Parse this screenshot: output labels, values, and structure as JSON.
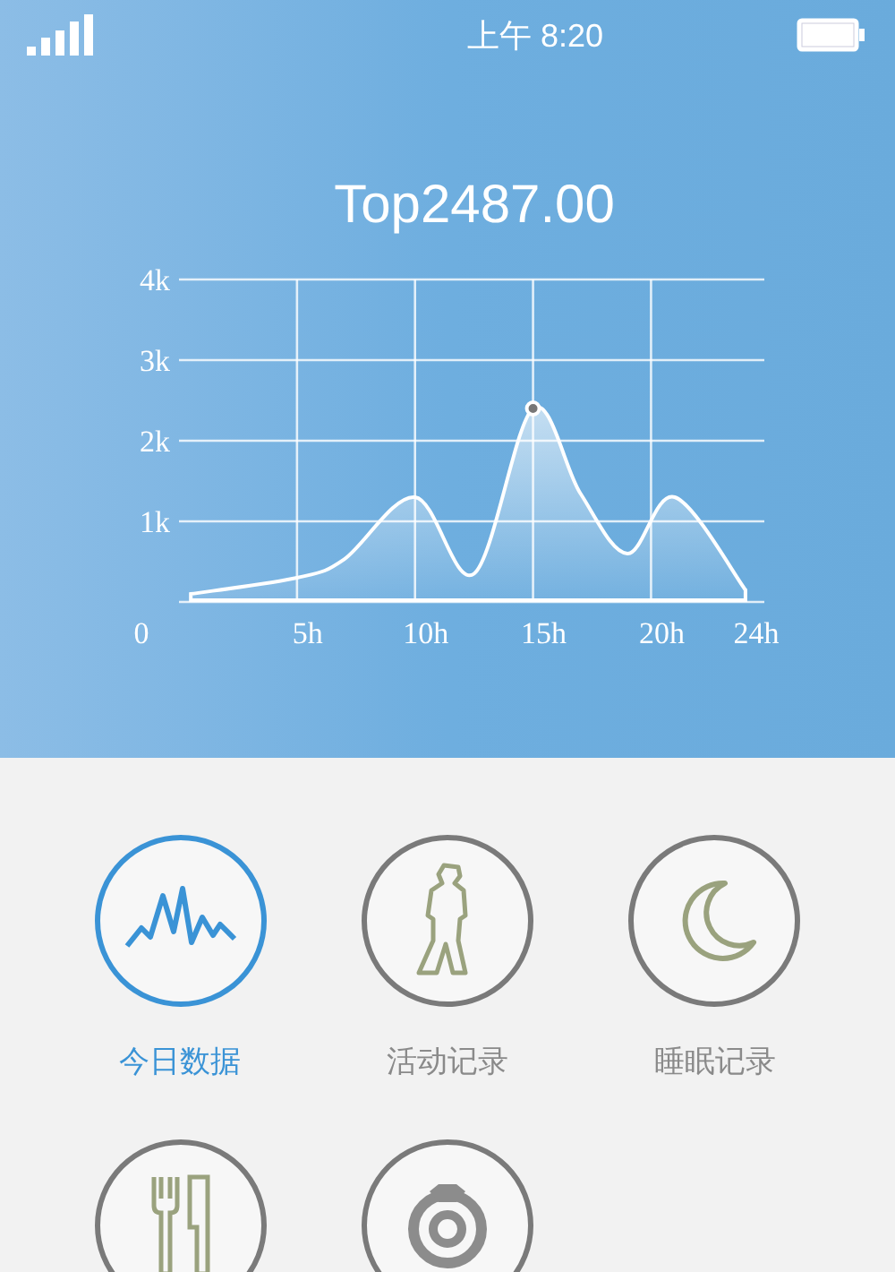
{
  "status_bar": {
    "time": "上午 8:20"
  },
  "peak_label": "Top2487.00",
  "chart": {
    "origin_label": "0",
    "chart_data": {
      "type": "area",
      "x": [
        0.5,
        5,
        7,
        10,
        12.5,
        15,
        17,
        19,
        21,
        24
      ],
      "series": [
        {
          "color": "#ffffff",
          "values": [
            100,
            300,
            530,
            1300,
            350,
            2400,
            1350,
            600,
            1300,
            150
          ]
        }
      ],
      "xlim": [
        0,
        24.8
      ],
      "grid": true,
      "ylim": [
        0,
        4000
      ],
      "xticks": [
        {
          "value": 5,
          "label": "5h"
        },
        {
          "value": 10,
          "label": "10h"
        },
        {
          "value": 15,
          "label": "15h"
        },
        {
          "value": 20,
          "label": "20h"
        },
        {
          "value": 24,
          "label": "24h"
        }
      ],
      "yticks": [
        {
          "value": 1000,
          "label": "1k"
        },
        {
          "value": 2000,
          "label": "2k"
        },
        {
          "value": 3000,
          "label": "3k"
        },
        {
          "value": 4000,
          "label": "4k"
        }
      ]
    }
  },
  "menu": [
    {
      "label": "今日数据",
      "kind": "wave",
      "selected": true
    },
    {
      "label": "活动记录",
      "kind": "figure",
      "selected": false
    },
    {
      "label": "睡眠记录",
      "kind": "moon",
      "selected": false
    },
    {
      "kind": "cutlery",
      "selected": false
    },
    {
      "kind": "dial",
      "selected": false
    }
  ]
}
